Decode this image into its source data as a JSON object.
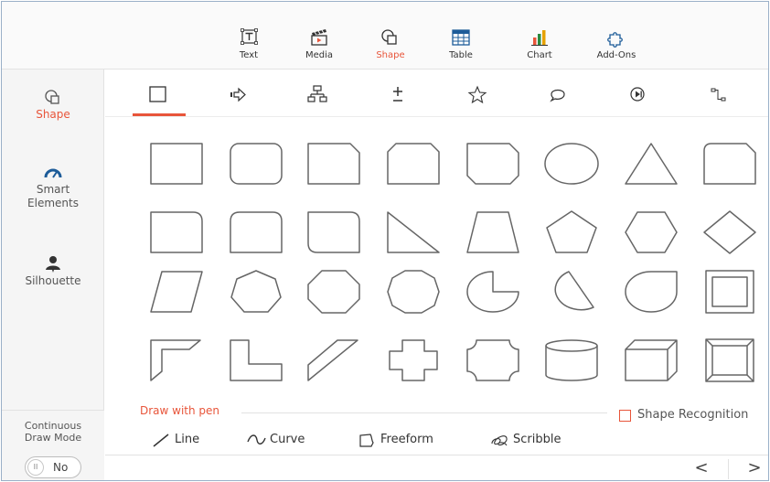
{
  "toolbar": {
    "items": [
      {
        "label": "Text",
        "icon": "text-icon"
      },
      {
        "label": "Media",
        "icon": "media-icon"
      },
      {
        "label": "Shape",
        "icon": "shape-icon",
        "active": true
      },
      {
        "label": "Table",
        "icon": "table-icon"
      },
      {
        "label": "Chart",
        "icon": "chart-icon"
      },
      {
        "label": "Add-Ons",
        "icon": "puzzle-icon"
      }
    ]
  },
  "sidebar": {
    "items": [
      {
        "label": "Shape",
        "icon": "shape-icon",
        "active": true
      },
      {
        "label": "Smart Elements",
        "icon": "gauge-icon"
      },
      {
        "label": "Silhouette",
        "icon": "person-icon"
      }
    ],
    "continuous_draw_mode": {
      "label": "Continuous Draw Mode",
      "toggle_value": "No",
      "knob_glyph": "II"
    }
  },
  "categories": {
    "items": [
      {
        "icon": "square-icon",
        "active": true
      },
      {
        "icon": "arrow-icon"
      },
      {
        "icon": "flowchart-icon"
      },
      {
        "icon": "plus-minus-icon"
      },
      {
        "icon": "star-icon"
      },
      {
        "icon": "speech-bubble-icon"
      },
      {
        "icon": "play-button-icon"
      },
      {
        "icon": "connector-icon"
      }
    ]
  },
  "shapes": [
    "rectangle",
    "rounded-rectangle",
    "snip-corner-rectangle",
    "snip-two-corner-rectangle",
    "snip-bottom-corners-rectangle",
    "ellipse",
    "triangle",
    "round-snip-rectangle",
    "round-one-corner-rectangle",
    "round-top-corners-rectangle",
    "round-diagonal-rectangle",
    "right-triangle",
    "trapezoid",
    "pentagon",
    "hexagon",
    "diamond",
    "parallelogram",
    "heptagon",
    "octagon",
    "decagon",
    "pie",
    "chord",
    "teardrop",
    "frame",
    "half-frame",
    "l-shape",
    "diagonal-stripe",
    "cross",
    "plaque",
    "can",
    "cube",
    "bevel"
  ],
  "pen": {
    "title": "Draw with pen",
    "shape_recognition": "Shape Recognition",
    "tools": [
      {
        "label": "Line",
        "icon": "line-icon"
      },
      {
        "label": "Curve",
        "icon": "curve-icon"
      },
      {
        "label": "Freeform",
        "icon": "freeform-icon"
      },
      {
        "label": "Scribble",
        "icon": "scribble-icon"
      }
    ]
  },
  "pager": {
    "prev": "<",
    "next": ">"
  },
  "colors": {
    "accent": "#e8553a",
    "stroke": "#666666",
    "border": "#e2e2e2"
  }
}
